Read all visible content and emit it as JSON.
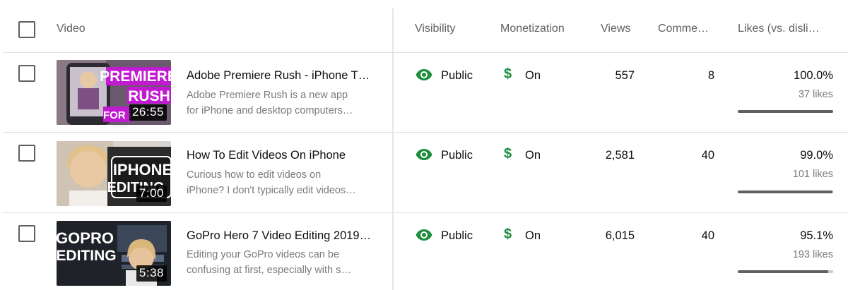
{
  "header": {
    "video": "Video",
    "visibility": "Visibility",
    "monetization": "Monetization",
    "views": "Views",
    "comments": "Comme…",
    "likes": "Likes (vs. disli…"
  },
  "colors": {
    "visibility_icon": "#1e8e3e",
    "monetization_icon": "#1e8e3e",
    "likes_bar_fill": "#606060",
    "likes_bar_track": "#cccccc"
  },
  "rows": [
    {
      "thumbnail_text": [
        "PREMIERE",
        "RUSH",
        "FOR i"
      ],
      "duration": "26:55",
      "title": "Adobe Premiere Rush - iPhone T…",
      "desc_line1": "Adobe Premiere Rush is a new app",
      "desc_line2": "for iPhone and desktop computers…",
      "visibility": "Public",
      "visibility_icon": "eye-icon",
      "monetization_symbol": "$",
      "monetization": "On",
      "views": "557",
      "comments": "8",
      "likes_pct": "100.0%",
      "likes_count": "37 likes",
      "likes_ratio": 1.0
    },
    {
      "thumbnail_text": [
        "IPHONE",
        "EDITING"
      ],
      "duration": "7:00",
      "title": "How To Edit Videos On iPhone",
      "desc_line1": "Curious how to edit videos on",
      "desc_line2": "iPhone? I don't typically edit videos…",
      "visibility": "Public",
      "visibility_icon": "eye-icon",
      "monetization_symbol": "$",
      "monetization": "On",
      "views": "2,581",
      "comments": "40",
      "likes_pct": "99.0%",
      "likes_count": "101 likes",
      "likes_ratio": 0.99
    },
    {
      "thumbnail_text": [
        "GOPRO",
        "EDITING"
      ],
      "duration": "5:38",
      "title": "GoPro Hero 7 Video Editing 2019…",
      "desc_line1": "Editing your GoPro videos can be",
      "desc_line2": "confusing at first, especially with s…",
      "visibility": "Public",
      "visibility_icon": "eye-icon",
      "monetization_symbol": "$",
      "monetization": "On",
      "views": "6,015",
      "comments": "40",
      "likes_pct": "95.1%",
      "likes_count": "193 likes",
      "likes_ratio": 0.951
    }
  ]
}
